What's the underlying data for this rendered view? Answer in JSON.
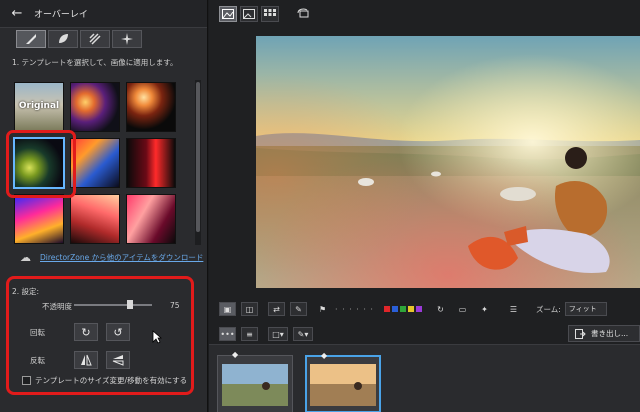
{
  "left_panel": {
    "title": "オーバーレイ",
    "tabs": [
      "overlay-brush-icon",
      "overlay-leaf-icon",
      "overlay-stripes-icon",
      "overlay-sparkle-icon"
    ],
    "hint": "1. テンプレートを選択して、画像に適用します。",
    "thumbnails": [
      {
        "label": "Original"
      },
      {
        "label": ""
      },
      {
        "label": ""
      },
      {
        "label": ""
      },
      {
        "label": ""
      },
      {
        "label": ""
      },
      {
        "label": ""
      },
      {
        "label": ""
      },
      {
        "label": ""
      }
    ],
    "download_link": "DirectorZone から他のアイテムをダウンロード",
    "settings": {
      "title": "2. 設定:",
      "opacity_label": "不透明度",
      "opacity_value": "75",
      "rotate_label": "回転",
      "flip_label": "反転",
      "checkbox_label": "テンプレートのサイズ変更/移動を有効にする"
    }
  },
  "right_panel": {
    "zoom_label": "ズーム:",
    "zoom_value": "フィット",
    "export_label": "書き出し..."
  },
  "colors": {
    "accent_red": "#e11b1b",
    "selected_blue": "#4aa3e8",
    "link": "#69a8e8"
  }
}
